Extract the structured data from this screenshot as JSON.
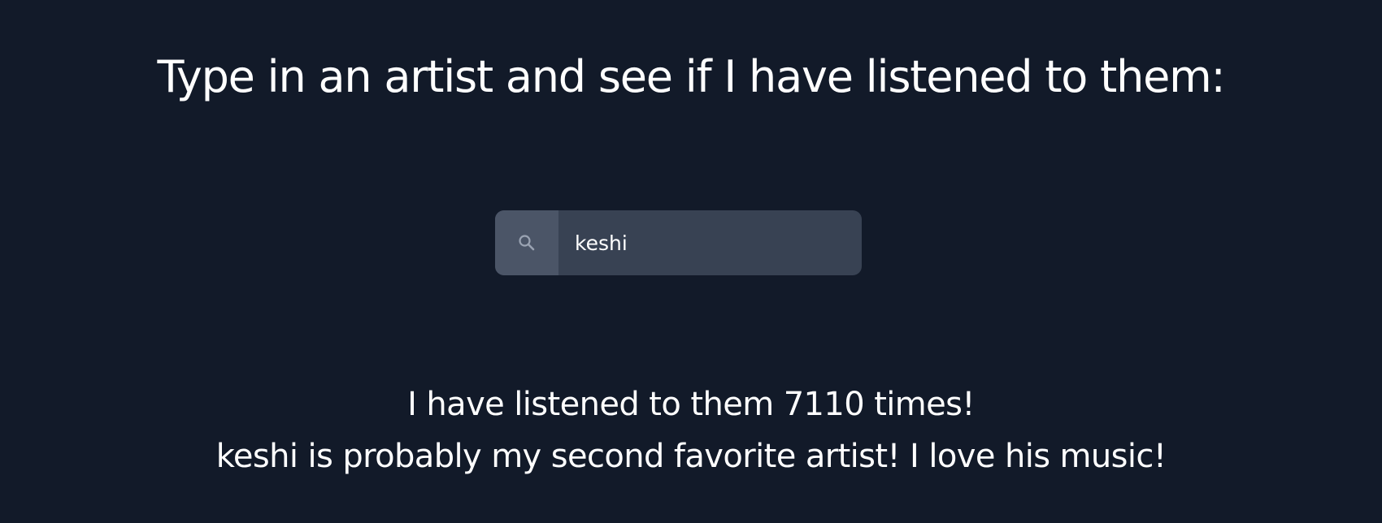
{
  "heading": "Type in an artist and see if I have listened to them:",
  "search": {
    "icon": "search-icon",
    "value": "keshi",
    "placeholder": ""
  },
  "result": {
    "count_line": "I have listened to them 7110 times!",
    "comment_line": "keshi is probably my second favorite artist! I love his music!"
  },
  "colors": {
    "background": "#121a29",
    "input_bg": "#384253",
    "addon_bg": "#4b5567",
    "text": "#ffffff"
  }
}
